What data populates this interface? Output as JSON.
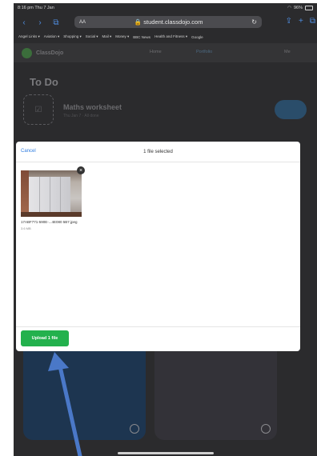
{
  "status": {
    "time": "8:16 pm",
    "date": "Thu 7 Jan",
    "battery": "96%"
  },
  "browser": {
    "url": "student.classdojo.com",
    "aa": "AA",
    "bookmarks": [
      "Angel Links ▾",
      "Aviation ▾",
      "Shopping ▾",
      "Social ▾",
      "Mail ▾",
      "Money ▾",
      "BBC News",
      "Health and Fitness ▾",
      "Google"
    ]
  },
  "app": {
    "brand": "ClassDojo",
    "nav": {
      "home": "Home",
      "portfolio": "Portfolio",
      "me": "Me"
    },
    "todo_title": "To Do",
    "task": {
      "title": "Maths worksheet",
      "subtitle": "Thu Jan 7 · All done"
    }
  },
  "modal": {
    "cancel": "Cancel",
    "title": "1 file selected",
    "file": {
      "name": "17ABF771-590E-...4E080 5B7.jpeg",
      "size": "3.6 MB"
    },
    "upload_label": "Upload 1 file"
  },
  "colors": {
    "upload": "#23b14d",
    "link": "#2f7ce0",
    "arrow": "#4a78c8"
  }
}
